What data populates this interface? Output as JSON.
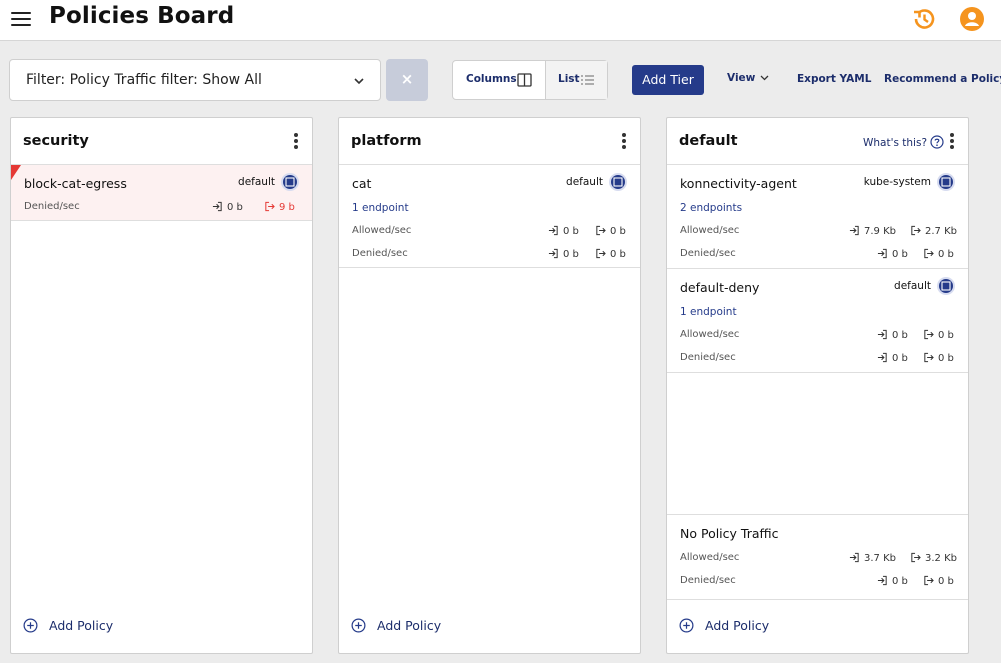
{
  "header": {
    "title": "Policies Board",
    "menu_icon": "hamburger-menu-icon",
    "history_icon": "history-icon",
    "user_icon": "user-account-icon",
    "accent_color": "#f5941e"
  },
  "toolbar": {
    "filter_value": "Filter: Policy Traffic filter: Show All",
    "clear_label": "×",
    "columns_label": "Columns",
    "list_label": "List",
    "add_tier_label": "Add Tier",
    "view_label": "View",
    "export_label": "Export YAML",
    "recommend_label": "Recommend a Policy",
    "brand_color": "#253b8a"
  },
  "tiers": [
    {
      "name": "security",
      "add_policy_label": "Add Policy",
      "policies": [
        {
          "name": "block-cat-egress",
          "namespace": "default",
          "denied_label": "Denied/sec",
          "denied_in": "0 b",
          "denied_out": "9 b",
          "alert_color": "#e53935"
        }
      ]
    },
    {
      "name": "platform",
      "add_policy_label": "Add Policy",
      "policies": [
        {
          "name": "cat",
          "namespace": "default",
          "endpoints": "1 endpoint",
          "allowed_label": "Allowed/sec",
          "allowed_in": "0 b",
          "allowed_out": "0 b",
          "denied_label": "Denied/sec",
          "denied_in": "0 b",
          "denied_out": "0 b"
        }
      ]
    },
    {
      "name": "default",
      "whats_this_label": "What's this?",
      "add_policy_label": "Add Policy",
      "policies": [
        {
          "name": "konnectivity-agent",
          "namespace": "kube-system",
          "endpoints": "2 endpoints",
          "allowed_label": "Allowed/sec",
          "allowed_in": "7.9 Kb",
          "allowed_out": "2.7 Kb",
          "denied_label": "Denied/sec",
          "denied_in": "0 b",
          "denied_out": "0 b"
        },
        {
          "name": "default-deny",
          "namespace": "default",
          "endpoints": "1 endpoint",
          "allowed_label": "Allowed/sec",
          "allowed_in": "0 b",
          "allowed_out": "0 b",
          "denied_label": "Denied/sec",
          "denied_in": "0 b",
          "denied_out": "0 b"
        }
      ],
      "no_policy_traffic": {
        "name": "No Policy Traffic",
        "allowed_label": "Allowed/sec",
        "allowed_in": "3.7 Kb",
        "allowed_out": "3.2 Kb",
        "denied_label": "Denied/sec",
        "denied_in": "0 b",
        "denied_out": "0 b"
      }
    }
  ]
}
